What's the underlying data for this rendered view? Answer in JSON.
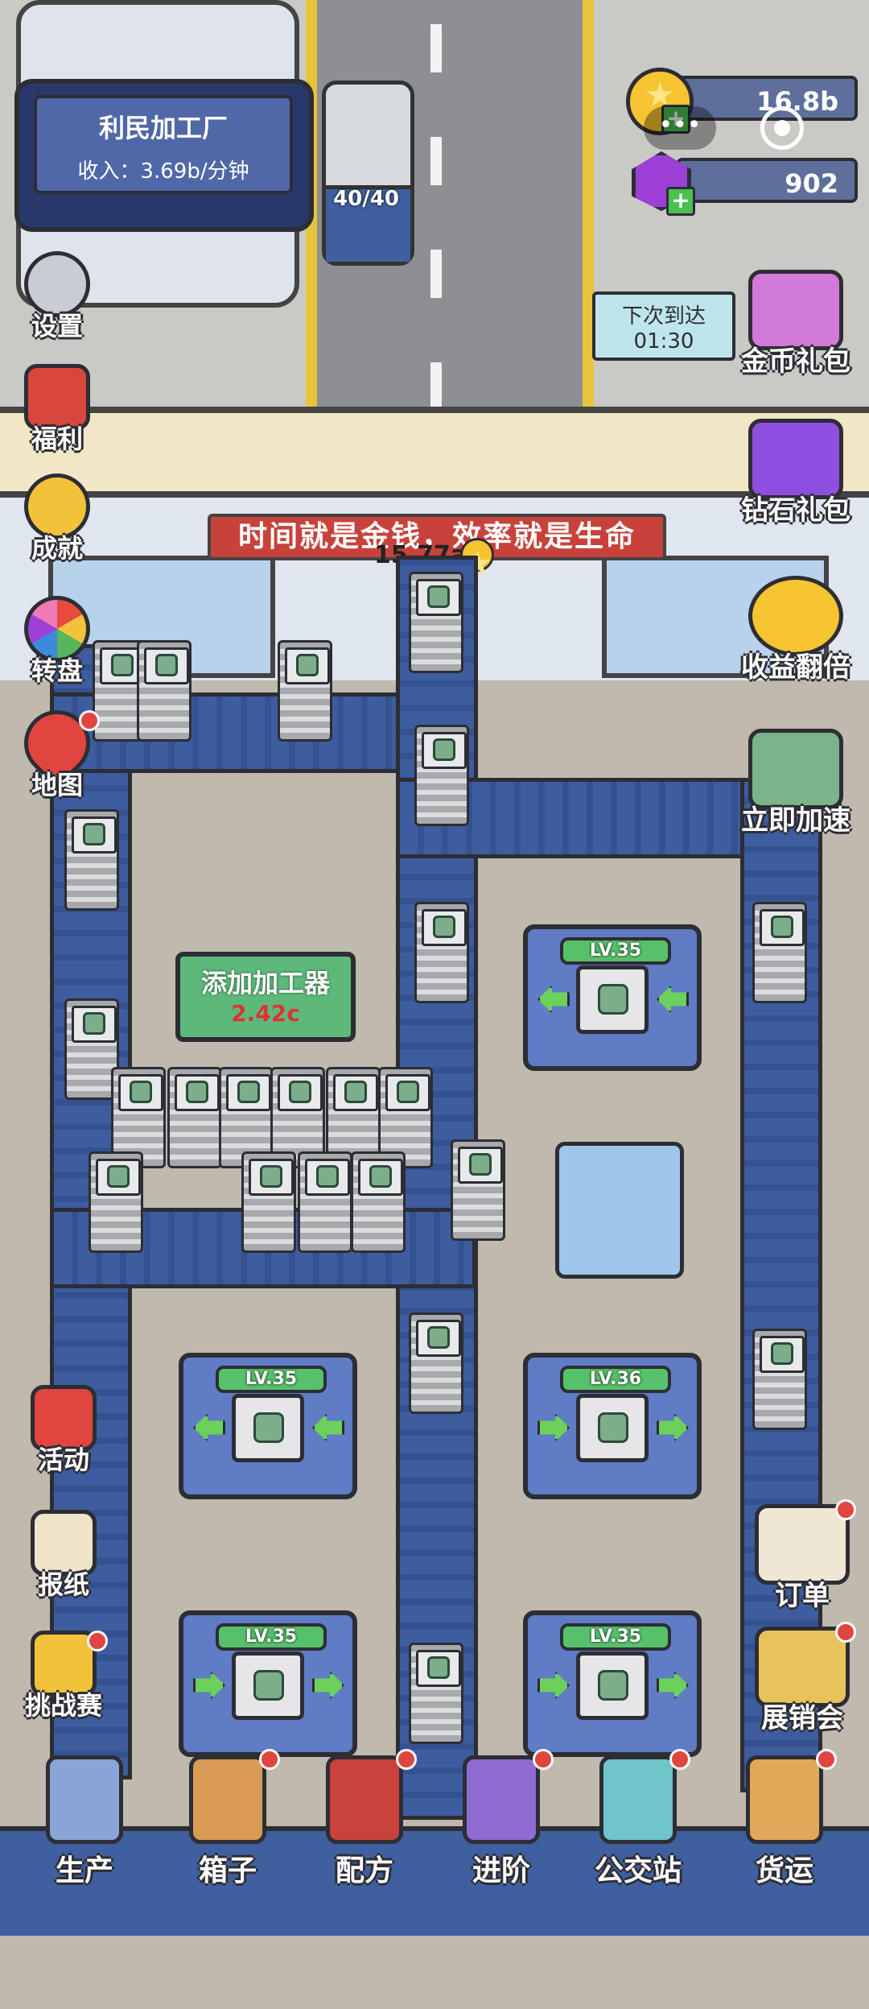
{
  "factory": {
    "name": "利民加工厂",
    "income": "收入：3.69b/分钟"
  },
  "truck": {
    "capacity": "40/40"
  },
  "currency": {
    "coins": "16.8b",
    "gems": "902",
    "menu_glyph": "•••"
  },
  "arrival": {
    "label": "下次到达",
    "time": "01:30"
  },
  "slogan": "时间就是金钱，效率就是生命",
  "floating_value": "15.77a",
  "left_menu": [
    {
      "label": "设置",
      "icon": "gear-icon"
    },
    {
      "label": "福利",
      "icon": "gift-icon"
    },
    {
      "label": "成就",
      "icon": "star-badge-icon"
    },
    {
      "label": "转盘",
      "icon": "wheel-icon"
    },
    {
      "label": "地图",
      "icon": "map-pin-icon"
    }
  ],
  "right_menu": [
    {
      "label": "金币礼包",
      "icon": "coin-pack-icon"
    },
    {
      "label": "钻石礼包",
      "icon": "gem-pack-icon"
    },
    {
      "label": "收益翻倍",
      "icon": "double-coins-icon"
    },
    {
      "label": "立即加速",
      "icon": "speed-up-icon"
    }
  ],
  "left_lower_menu": [
    {
      "label": "活动",
      "icon": "event-gift-icon"
    },
    {
      "label": "报纸",
      "icon": "newspaper-icon"
    },
    {
      "label": "挑战赛",
      "icon": "trophy-icon"
    }
  ],
  "right_lower_menu": [
    {
      "label": "订单",
      "icon": "clipboard-icon"
    },
    {
      "label": "展销会",
      "icon": "billboard-icon"
    }
  ],
  "add_processor": {
    "title": "添加加工器",
    "cost": "2.42c"
  },
  "machines": [
    {
      "level": "LV.35"
    },
    {
      "level": "LV.35"
    },
    {
      "level": "LV.36"
    },
    {
      "level": "LV.35"
    },
    {
      "level": "LV.35"
    }
  ],
  "bottom_nav": [
    {
      "label": "生产",
      "icon": "robot-arm-icon"
    },
    {
      "label": "箱子",
      "icon": "crates-icon"
    },
    {
      "label": "配方",
      "icon": "recipe-book-icon"
    },
    {
      "label": "进阶",
      "icon": "advance-arrows-icon"
    },
    {
      "label": "公交站",
      "icon": "bus-stop-icon"
    },
    {
      "label": "货运",
      "icon": "cargo-icon"
    }
  ],
  "colors": {
    "belt": "#3d5d9e",
    "level_bar": "#56c16a",
    "alert_dot": "#e0463f",
    "coin": "#f5c430",
    "gem": "#9d3fd7"
  }
}
